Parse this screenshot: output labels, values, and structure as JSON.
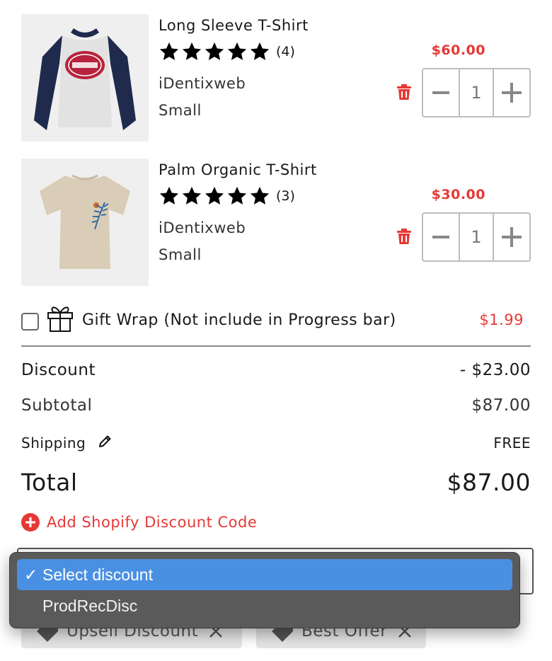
{
  "cart_items": [
    {
      "title": "Long Sleeve T-Shirt",
      "rating_count": "(4)",
      "stars": 5,
      "vendor": "iDentixweb",
      "variant": "Small",
      "price": "$60.00",
      "quantity": "1"
    },
    {
      "title": "Palm Organic T-Shirt",
      "rating_count": "(3)",
      "stars": 5,
      "vendor": "iDentixweb",
      "variant": "Small",
      "price": "$30.00",
      "quantity": "1"
    }
  ],
  "gift_wrap": {
    "label": "Gift Wrap (Not include in Progress bar)",
    "price": "$1.99",
    "checked": false
  },
  "summary": {
    "discount_label": "Discount",
    "discount_value": "- $23.00",
    "subtotal_label": "Subtotal",
    "subtotal_value": "$87.00",
    "shipping_label": "Shipping",
    "shipping_value": "FREE",
    "total_label": "Total",
    "total_value": "$87.00"
  },
  "discount_code": {
    "label": "Add Shopify Discount Code"
  },
  "discount_select": {
    "options": [
      {
        "label": "Select discount",
        "selected": true
      },
      {
        "label": "ProdRecDisc",
        "selected": false
      }
    ]
  },
  "applied_discounts": [
    {
      "label": "Upsell Discount"
    },
    {
      "label": "Best Offer"
    }
  ],
  "colors": {
    "accent_red": "#e53935",
    "select_highlight": "#4a90e2",
    "dropdown_bg": "#5a5a5a"
  },
  "icons": {
    "trash": "trash-icon",
    "minus": "minus-icon",
    "plus": "plus-icon",
    "gift": "gift-icon",
    "pencil": "pencil-icon",
    "add": "add-circle-icon",
    "tag": "tag-icon",
    "remove": "x-icon",
    "star": "star-icon",
    "check": "checkmark-icon"
  }
}
